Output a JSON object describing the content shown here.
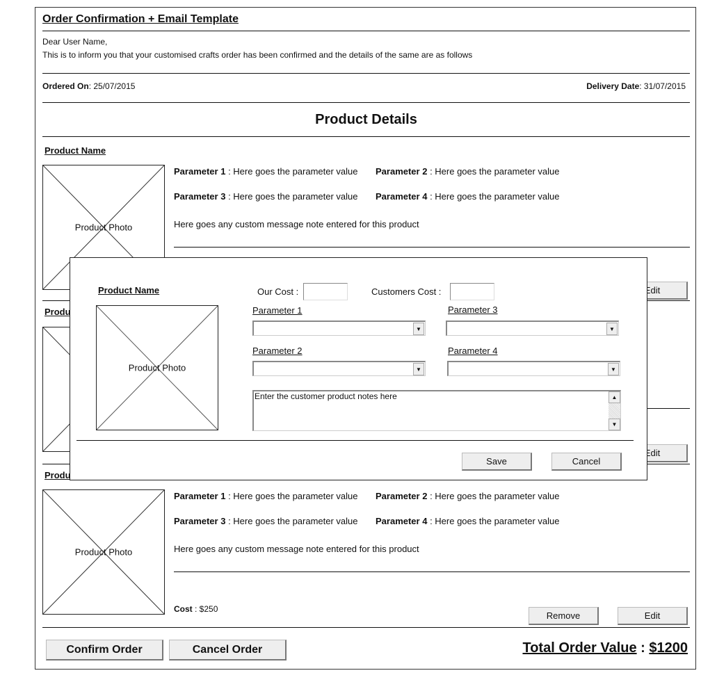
{
  "title": "Order Confirmation +  Email Template",
  "greeting": "Dear User Name,",
  "intro": "This is to inform you that your customised crafts order has been confirmed and the details of the same are as follows",
  "ordered_on": {
    "label": "Ordered On",
    "value": ": 25/07/2015"
  },
  "delivery_date": {
    "label": "Delivery Date",
    "value": ": 31/07/2015"
  },
  "section_title": "Product Details",
  "products": [
    {
      "name": "Product Name",
      "photo": "Product Photo",
      "params": [
        {
          "label": "Parameter 1",
          "value": " : Here goes the parameter value"
        },
        {
          "label": "Parameter 2",
          "value": " : Here goes the parameter value"
        },
        {
          "label": "Parameter 3",
          "value": " : Here goes the parameter value"
        },
        {
          "label": "Parameter 4",
          "value": " : Here goes the parameter value"
        }
      ],
      "note": "Here goes any custom message note entered for this product",
      "edit": "Edit"
    },
    {
      "name": "Produ",
      "edit": "Edit"
    },
    {
      "name": "Produ",
      "photo": "Product Photo",
      "params": [
        {
          "label": "Parameter 1",
          "value": " : Here goes the parameter value"
        },
        {
          "label": "Parameter 2",
          "value": " : Here goes the parameter value"
        },
        {
          "label": "Parameter 3",
          "value": " : Here goes the parameter value"
        },
        {
          "label": "Parameter 4",
          "value": " : Here goes the parameter value"
        }
      ],
      "note": "Here goes any custom message note entered for this product",
      "cost_label": "Cost",
      "cost_value": " : $250",
      "remove": "Remove",
      "edit": "Edit"
    }
  ],
  "footer": {
    "confirm": "Confirm Order",
    "cancel": "Cancel Order",
    "total_label": "Total Order Value",
    "sep": " : ",
    "total_value": "$1200"
  },
  "modal": {
    "product_name": "Product Name",
    "photo": "Product Photo",
    "our_cost": "Our Cost :",
    "customers_cost": "Customers Cost :",
    "param1": "Parameter 1",
    "param2": "Parameter 2",
    "param3": "Parameter 3",
    "param4": "Parameter 4",
    "notes": "Enter the customer product notes here",
    "save": "Save",
    "cancel": "Cancel"
  }
}
